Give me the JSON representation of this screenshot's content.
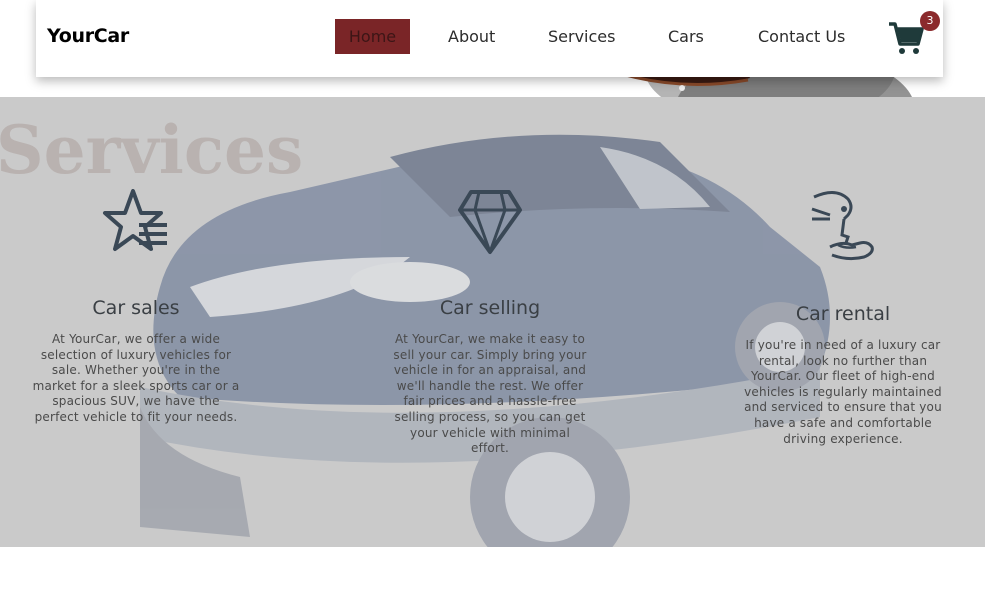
{
  "navbar": {
    "brand": "YourCar",
    "items": [
      {
        "label": "Home",
        "active": true
      },
      {
        "label": "About"
      },
      {
        "label": "Services"
      },
      {
        "label": "Cars"
      },
      {
        "label": "Contact Us"
      }
    ],
    "cart": {
      "icon": "shopping-cart-icon",
      "count": "3"
    }
  },
  "services": {
    "title": "Services",
    "items": [
      {
        "icon": "star-list-icon",
        "title": "Car sales",
        "text": "At YourCar, we offer a wide selection of luxury vehicles for sale. Whether you're in the market for a sleek sports car or a spacious SUV, we have the perfect vehicle to fit your needs."
      },
      {
        "icon": "diamond-icon",
        "title": "Car selling",
        "text": "At YourCar, we make it easy to sell your car. Simply bring your vehicle in for an appraisal, and we'll handle the rest. We offer fair prices and a hassle-free selling process, so you can get your vehicle with minimal effort."
      },
      {
        "icon": "key-hand-icon",
        "title": "Car rental",
        "text": "If you're in need of a luxury car rental, look no further than YourCar. Our fleet of high-end vehicles is regularly maintained and serviced to ensure that you have a safe and comfortable driving experience."
      }
    ]
  },
  "colors": {
    "accent": "#7a2527",
    "badge": "#8b2a2c",
    "icon": "#3a4856",
    "section_bg": "#cacaca"
  }
}
